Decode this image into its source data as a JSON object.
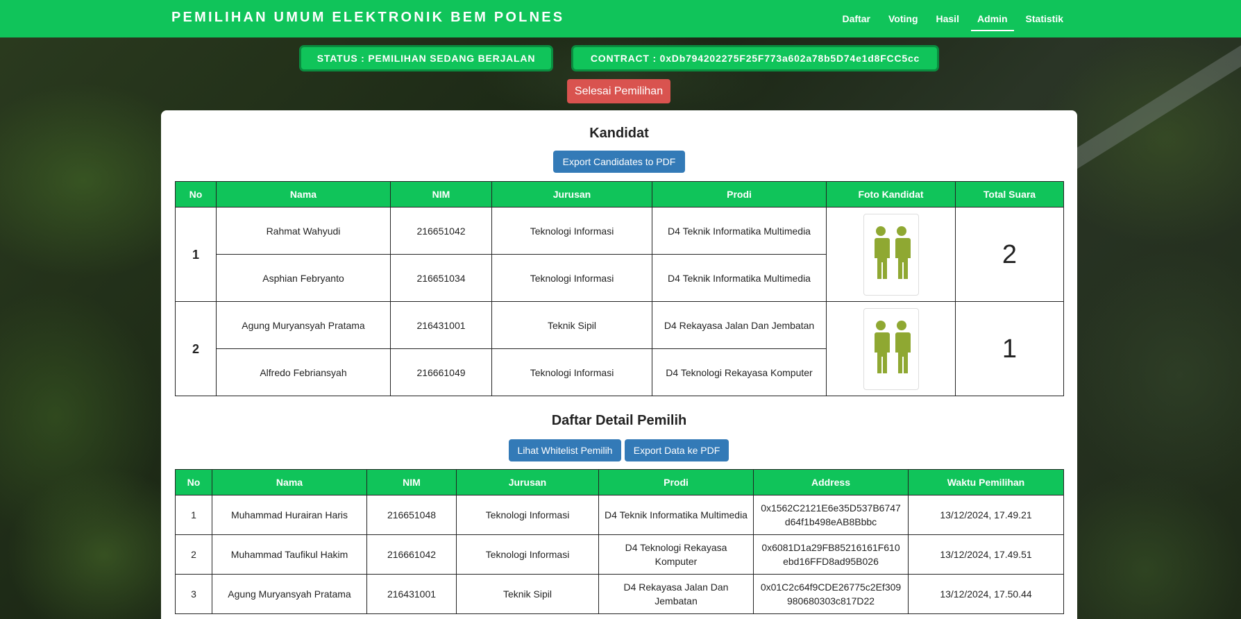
{
  "brand": "PEMILIHAN UMUM ELEKTRONIK BEM POLNES",
  "nav": [
    {
      "label": "Daftar",
      "active": false
    },
    {
      "label": "Voting",
      "active": false
    },
    {
      "label": "Hasil",
      "active": false
    },
    {
      "label": "Admin",
      "active": true
    },
    {
      "label": "Statistik",
      "active": false
    }
  ],
  "status_text": "STATUS : PEMILIHAN SEDANG BERJALAN",
  "contract_text": "CONTRACT : 0xDb794202275F25F773a602a78b5D74e1d8FCC5cc",
  "finish_button": "Selesai Pemilihan",
  "candidates": {
    "title": "Kandidat",
    "export_button": "Export Candidates to PDF",
    "headers": [
      "No",
      "Nama",
      "NIM",
      "Jurusan",
      "Prodi",
      "Foto Kandidat",
      "Total Suara"
    ],
    "groups": [
      {
        "no": "1",
        "votes": "2",
        "photo_icon": "couple-silhouette-icon",
        "members": [
          {
            "nama": "Rahmat Wahyudi",
            "nim": "216651042",
            "jurusan": "Teknologi Informasi",
            "prodi": "D4 Teknik Informatika Multimedia"
          },
          {
            "nama": "Asphian Febryanto",
            "nim": "216651034",
            "jurusan": "Teknologi Informasi",
            "prodi": "D4 Teknik Informatika Multimedia"
          }
        ]
      },
      {
        "no": "2",
        "votes": "1",
        "photo_icon": "couple-silhouette-icon",
        "members": [
          {
            "nama": "Agung Muryansyah Pratama",
            "nim": "216431001",
            "jurusan": "Teknik Sipil",
            "prodi": "D4 Rekayasa Jalan Dan Jembatan"
          },
          {
            "nama": "Alfredo Febriansyah",
            "nim": "216661049",
            "jurusan": "Teknologi Informasi",
            "prodi": "D4 Teknologi Rekayasa Komputer"
          }
        ]
      }
    ]
  },
  "voters": {
    "title": "Daftar Detail Pemilih",
    "whitelist_button": "Lihat Whitelist Pemilih",
    "export_button": "Export Data ke PDF",
    "headers": [
      "No",
      "Nama",
      "NIM",
      "Jurusan",
      "Prodi",
      "Address",
      "Waktu Pemilihan"
    ],
    "rows": [
      {
        "no": "1",
        "nama": "Muhammad Hurairan Haris",
        "nim": "216651048",
        "jurusan": "Teknologi Informasi",
        "prodi": "D4 Teknik Informatika Multimedia",
        "address": "0x1562C2121E6e35D537B6747d64f1b498eAB8Bbbc",
        "address_line1": "0x1562C2121E6e35D537B6747",
        "address_line2": "d64f1b498eAB8Bbbc",
        "waktu": "13/12/2024, 17.49.21"
      },
      {
        "no": "2",
        "nama": "Muhammad Taufikul Hakim",
        "nim": "216661042",
        "jurusan": "Teknologi Informasi",
        "prodi": "D4 Teknologi Rekayasa Komputer",
        "address": "0x6081D1a29FB85216161F610ebd16FFD8ad95B026",
        "address_line1": "0x6081D1a29FB85216161F610",
        "address_line2": "ebd16FFD8ad95B026",
        "waktu": "13/12/2024, 17.49.51"
      },
      {
        "no": "3",
        "nama": "Agung Muryansyah Pratama",
        "nim": "216431001",
        "jurusan": "Teknik Sipil",
        "prodi": "D4 Rekayasa Jalan Dan Jembatan",
        "address": "0x01C2c64f9CDE26775c2Ef309980680303c817D22",
        "address_line1": "0x01C2c64f9CDE26775c2Ef309",
        "address_line2": "980680303c817D22",
        "waktu": "13/12/2024, 17.50.44"
      }
    ]
  },
  "colors": {
    "primary": "#10c45a",
    "danger": "#d9534f",
    "info": "#337ab7",
    "icon": "#8fa832"
  }
}
